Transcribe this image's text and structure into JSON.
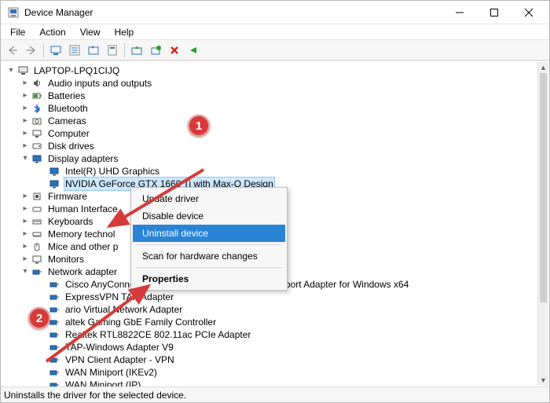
{
  "window": {
    "title": "Device Manager"
  },
  "menu": {
    "file": "File",
    "action": "Action",
    "view": "View",
    "help": "Help"
  },
  "tree": {
    "root": "LAPTOP-LPQ1CIJQ",
    "audio": "Audio inputs and outputs",
    "batteries": "Batteries",
    "bluetooth": "Bluetooth",
    "cameras": "Cameras",
    "computer": "Computer",
    "disk": "Disk drives",
    "display": "Display adapters",
    "display_intel": "Intel(R) UHD Graphics",
    "display_nvidia": "NVIDIA GeForce GTX 1660 Ti with Max-Q Design",
    "firmware": "Firmware",
    "hid": "Human Interface",
    "keyboards": "Keyboards",
    "memory": "Memory technol",
    "mice": "Mice and other p",
    "monitors": "Monitors",
    "network": "Network adapter",
    "net_cisco": "Cisco AnyConnect Secure Mobility Client Virtual Miniport Adapter for Windows x64",
    "net_express": "ExpressVPN TAP Adapter",
    "net_virtual": "ario Virtual Network Adapter",
    "net_realtekgbe": "altek Gaming GbE Family Controller",
    "net_realtekpcie": "Realtek RTL8822CE 802.11ac PCIe Adapter",
    "net_tap": "TAP-Windows Adapter V9",
    "net_vpnclient": "VPN Client Adapter - VPN",
    "net_wan_ikev2": "WAN Miniport (IKEv2)",
    "net_wan_ip": "WAN Miniport (IP)"
  },
  "context": {
    "update": "Update driver",
    "disable": "Disable device",
    "uninstall": "Uninstall device",
    "scan": "Scan for hardware changes",
    "properties": "Properties"
  },
  "callouts": {
    "one": "1",
    "two": "2"
  },
  "status": {
    "text": "Uninstalls the driver for the selected device."
  }
}
